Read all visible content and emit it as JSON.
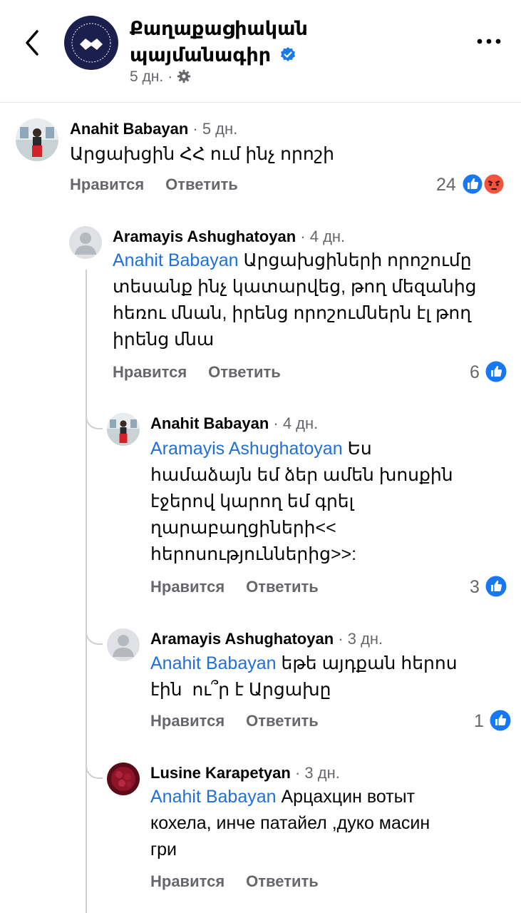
{
  "header": {
    "page_name_line1": "Քաղաքացիական",
    "page_name_line2": "պայմանագիր",
    "time": "5 дн.",
    "dot": "·"
  },
  "comments": [
    {
      "author": "Anahit Babayan",
      "time": "· 5 дн.",
      "lines": [
        "Արցախցին ՀՀ ում ինչ որոշի"
      ],
      "like_label": "Нравится",
      "reply_label": "Ответить",
      "reaction_count": "24",
      "reactions": [
        "like",
        "angry"
      ]
    },
    {
      "author": "Aramayis Ashughatoyan",
      "time": "· 4 дн.",
      "mention": "Anahit Babayan",
      "lines": [
        "Արցախցիների որոշումը",
        "տեսանք ինչ կատարվեց, թող մեզանից",
        "հեռու մնան, իրենց որոշումներն էլ թող",
        "իրենց մնա"
      ],
      "like_label": "Нравится",
      "reply_label": "Ответить",
      "reaction_count": "6",
      "reactions": [
        "like"
      ]
    },
    {
      "author": "Anahit Babayan",
      "time": "· 4 дн.",
      "mention": "Aramayis Ashughatoyan",
      "lines": [
        "Ես",
        "համաձայն եմ ձեր ամեն խոսքին",
        "էջերով կարող եմ գրել",
        "ղարաբաղցիների<<",
        "հերոսություններից>>:"
      ],
      "like_label": "Нравится",
      "reply_label": "Ответить",
      "reaction_count": "3",
      "reactions": [
        "like"
      ]
    },
    {
      "author": "Aramayis Ashughatoyan",
      "time": "· 3 дн.",
      "mention": "Anahit Babayan",
      "lines": [
        "եթե այդքան հերոս",
        "էին  ու՞ր է Արցախը"
      ],
      "like_label": "Нравится",
      "reply_label": "Ответить",
      "reaction_count": "1",
      "reactions": [
        "like"
      ]
    },
    {
      "author": "Lusine Karapetyan",
      "time": "· 3 дн.",
      "mention": "Anahit Babayan",
      "lines": [
        "Арцахцин вотыт",
        "кохела, инче патайел ,дуко масин",
        "гри"
      ],
      "like_label": "Нравится",
      "reply_label": "Ответить"
    }
  ],
  "colors": {
    "mention": "#216fdb",
    "like_blue": "#1877f2",
    "muted": "#65676b",
    "angry": "#f5533d"
  }
}
